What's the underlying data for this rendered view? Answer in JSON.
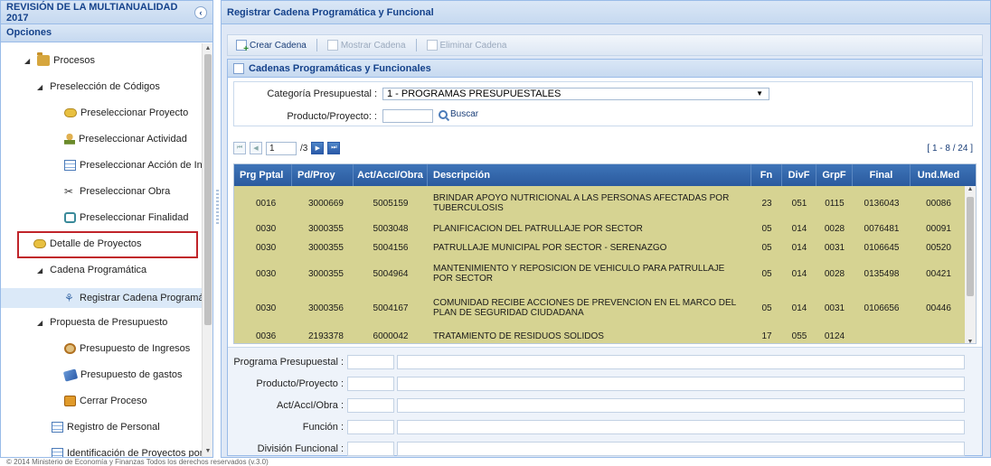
{
  "left": {
    "title": "REVISIÓN DE LA MULTIANUALIDAD 2017",
    "options_label": "Opciones",
    "collapse_icon": "‹"
  },
  "tree": [
    {
      "label": "Procesos",
      "icon": "folder-icon",
      "expanded": true
    },
    {
      "label": "Preselección de Códigos",
      "icon": "",
      "expanded": true
    },
    {
      "label": "Preseleccionar Proyecto",
      "icon": "leaf-icon"
    },
    {
      "label": "Preseleccionar Actividad",
      "icon": "person-icon"
    },
    {
      "label": "Preseleccionar Acción de Invers",
      "icon": "grid-icon"
    },
    {
      "label": "Preseleccionar Obra",
      "icon": "tools-icon"
    },
    {
      "label": "Preseleccionar Finalidad",
      "icon": "target-icon"
    },
    {
      "label": "Detalle de Proyectos",
      "icon": "leaf-icon"
    },
    {
      "label": "Cadena Programática",
      "icon": "",
      "expanded": true
    },
    {
      "label": "Registrar Cadena Programática",
      "icon": "tree-icon",
      "selected": true
    },
    {
      "label": "Propuesta de Presupuesto",
      "icon": "",
      "expanded": true
    },
    {
      "label": "Presupuesto de Ingresos",
      "icon": "coins-icon"
    },
    {
      "label": "Presupuesto de gastos",
      "icon": "money-icon"
    },
    {
      "label": "Cerrar Proceso",
      "icon": "close-process-icon"
    },
    {
      "label": "Registro de Personal",
      "icon": "grid-icon"
    },
    {
      "label": "Identificación de Proyectos por Proc",
      "icon": "grid-icon"
    }
  ],
  "right": {
    "title": "Registrar Cadena Programática y Funcional"
  },
  "toolbar": {
    "crear": "Crear Cadena",
    "mostrar": "Mostrar Cadena",
    "eliminar": "Eliminar Cadena"
  },
  "panel": {
    "title": "Cadenas Programáticas y Funcionales"
  },
  "filters": {
    "categoria_label": "Categoría Presupuestal :",
    "categoria_value": "1 - PROGRAMAS PRESUPUESTALES",
    "producto_label": "Producto/Proyecto: :",
    "producto_value": "",
    "buscar": "Buscar"
  },
  "pager": {
    "page": "1",
    "of": "/3",
    "range": "[ 1 - 8 / 24 ]"
  },
  "grid": {
    "columns": [
      "Prg Pptal",
      "Pd/Proy",
      "Act/AccI/Obra",
      "Descripción",
      "Fn",
      "DivF",
      "GrpF",
      "Final",
      "Und.Med"
    ],
    "rows": [
      [
        "0016",
        "3000669",
        "5005159",
        "BRINDAR APOYO NUTRICIONAL A LAS PERSONAS AFECTADAS POR TUBERCULOSIS",
        "23",
        "051",
        "0115",
        "0136043",
        "00086"
      ],
      [
        "0030",
        "3000355",
        "5003048",
        "PLANIFICACION DEL PATRULLAJE POR SECTOR",
        "05",
        "014",
        "0028",
        "0076481",
        "00091"
      ],
      [
        "0030",
        "3000355",
        "5004156",
        "PATRULLAJE MUNICIPAL POR SECTOR - SERENAZGO",
        "05",
        "014",
        "0031",
        "0106645",
        "00520"
      ],
      [
        "0030",
        "3000355",
        "5004964",
        "MANTENIMIENTO Y REPOSICION DE VEHICULO PARA PATRULLAJE POR SECTOR",
        "05",
        "014",
        "0028",
        "0135498",
        "00421"
      ],
      [
        "0030",
        "3000356",
        "5004167",
        "COMUNIDAD RECIBE ACCIONES DE PREVENCION EN EL MARCO DEL PLAN DE SEGURIDAD CIUDADANA",
        "05",
        "014",
        "0031",
        "0106656",
        "00446"
      ],
      [
        "0036",
        "2193378",
        "6000042",
        "TRATAMIENTO DE RESIDUOS SOLIDOS",
        "17",
        "055",
        "0124",
        "",
        ""
      ]
    ]
  },
  "form": {
    "labels": [
      "Programa Presupuestal :",
      "Producto/Proyecto :",
      "Act/AccI/Obra :",
      "Función :",
      "División Funcional :"
    ]
  },
  "footer": "© 2014 Ministerio de Economía y Finanzas Todos los derechos reservados (v.3.0)"
}
